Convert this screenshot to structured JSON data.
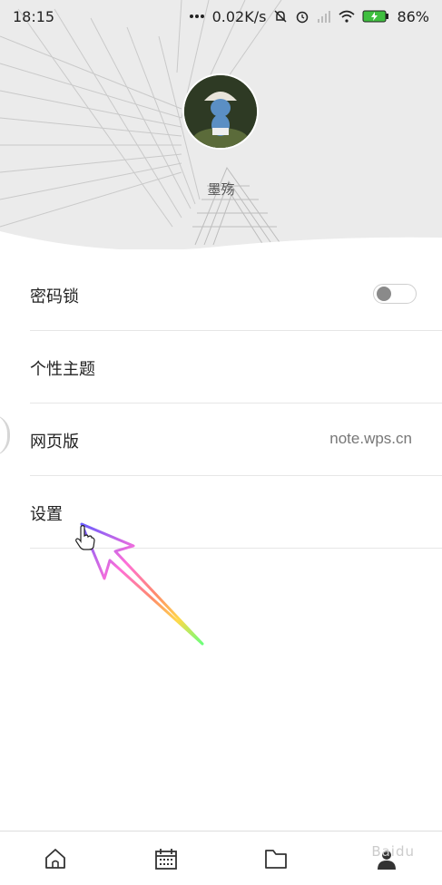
{
  "status_bar": {
    "time": "18:15",
    "network_speed": "0.02K/s",
    "battery_percent": "86%",
    "icons": [
      "more-dots-icon",
      "mute-bell-icon",
      "alarm-icon",
      "signal-icon",
      "wifi-icon",
      "battery-charging-icon"
    ]
  },
  "profile": {
    "avatar_icon": "avatar-image",
    "username": "墨殇"
  },
  "settings_list": [
    {
      "label": "密码锁",
      "control": "toggle",
      "toggle_on": false
    },
    {
      "label": "个性主题"
    },
    {
      "label": "网页版",
      "value": "note.wps.cn"
    },
    {
      "label": "设置"
    }
  ],
  "bottom_nav": {
    "items": [
      "home-icon",
      "calendar-icon",
      "folder-icon",
      "profile-icon"
    ]
  },
  "watermark": "Baidu"
}
